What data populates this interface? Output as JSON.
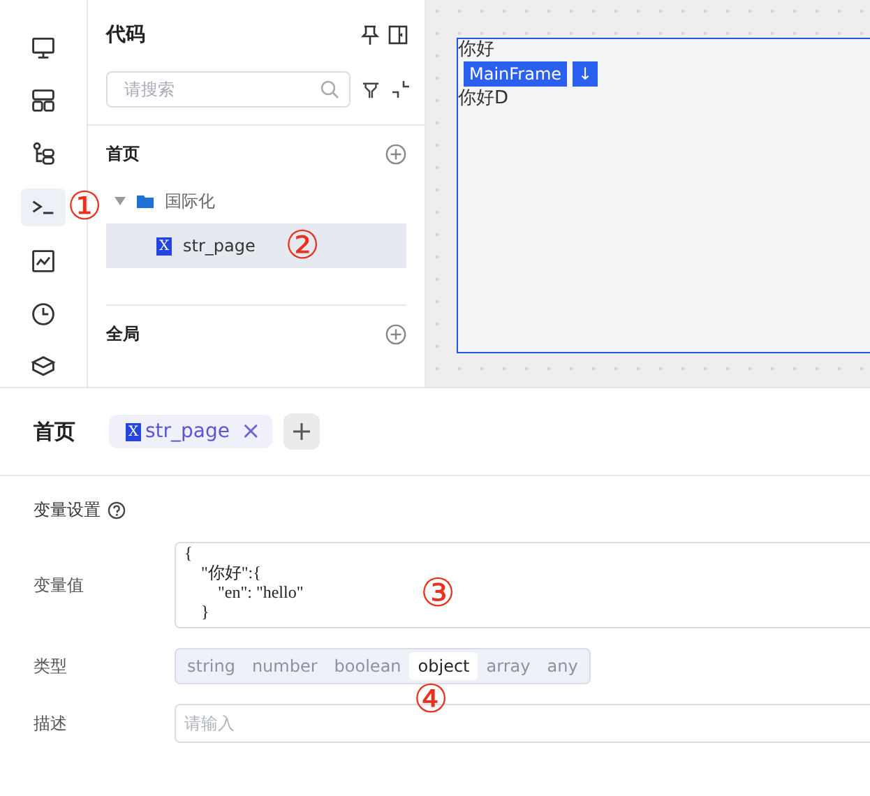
{
  "rail": [
    {
      "selected": false
    },
    {
      "selected": false
    },
    {
      "selected": false
    },
    {
      "selected": true,
      "annotation": "①"
    },
    {
      "selected": false
    },
    {
      "selected": false
    },
    {
      "selected": false
    }
  ],
  "panel": {
    "title": "代码",
    "search": {
      "placeholder": "请搜索"
    },
    "sections": [
      {
        "title": "首页",
        "children": [
          {
            "label": "国际化",
            "kind": "folder",
            "expanded": true,
            "selected": false,
            "children": [
              {
                "label": "str_page",
                "kind": "file",
                "icon_letter": "X",
                "selected": true,
                "annotation": "②"
              }
            ]
          }
        ]
      },
      {
        "title": "全局"
      }
    ]
  },
  "canvas": {
    "frame": {
      "texts": [
        "你好",
        "你好D"
      ],
      "badge": "MainFrame",
      "badge_arrow": "↓"
    }
  },
  "editor": {
    "page_title": "首页",
    "tabs": [
      {
        "icon_letter": "X",
        "label": "str_page",
        "close": "×",
        "selected": true
      }
    ],
    "section_title": "变量设置",
    "value_label": "变量值",
    "code_lines": [
      "{",
      "    \"你好\":{",
      "        \"en\": \"hello\"",
      "    }"
    ],
    "value_annotation": "③",
    "type_label": "类型",
    "types": [
      {
        "label": "string",
        "selected": false
      },
      {
        "label": "number",
        "selected": false
      },
      {
        "label": "boolean",
        "selected": false
      },
      {
        "label": "object",
        "selected": true
      },
      {
        "label": "array",
        "selected": false
      },
      {
        "label": "any",
        "selected": false
      }
    ],
    "type_annotation": "④",
    "desc_label": "描述",
    "desc": {
      "placeholder": "请输入"
    }
  }
}
